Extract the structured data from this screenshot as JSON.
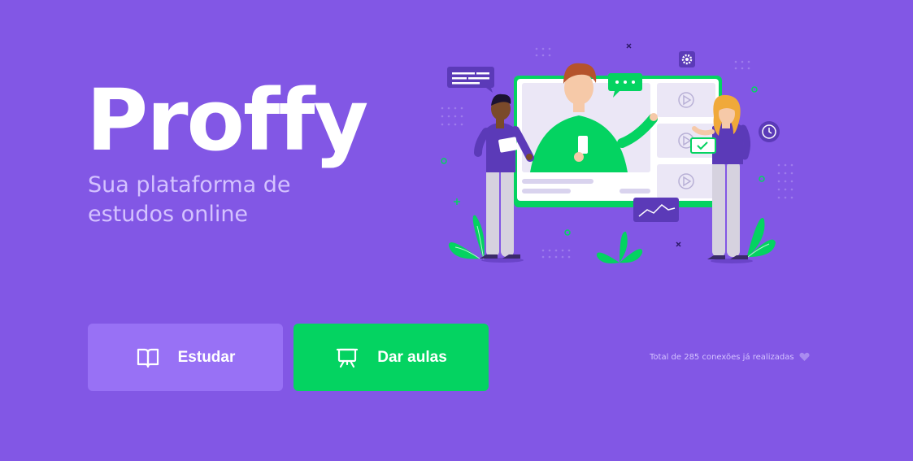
{
  "brand": {
    "logo": "Proffy",
    "tagline": "Sua plataforma de estudos online"
  },
  "actions": {
    "study": {
      "label": "Estudar",
      "icon": "book-open-icon"
    },
    "teach": {
      "label": "Dar aulas",
      "icon": "presentation-board-icon"
    }
  },
  "footer": {
    "connections_text": "Total de 285 conexões já realizadas",
    "icon": "purple-heart-icon"
  },
  "colors": {
    "background": "#8257e5",
    "primary_light": "#9871f5",
    "secondary": "#04d361",
    "text_in_primary": "#d4c2ff"
  }
}
